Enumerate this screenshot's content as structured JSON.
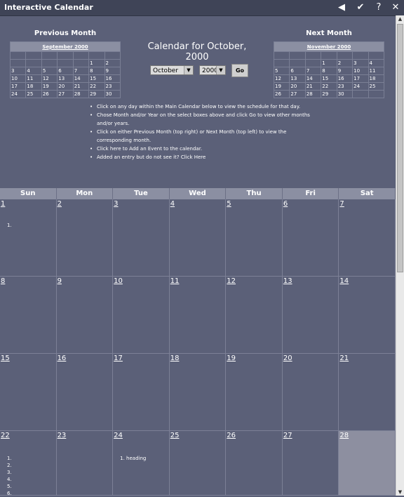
{
  "window": {
    "title": "Interactive Calendar",
    "buttons": [
      "◀",
      "✔",
      "?",
      "✕"
    ]
  },
  "prev": {
    "heading": "Previous Month",
    "month_label": "September 2000",
    "rows": [
      [
        "",
        "",
        "",
        "",
        "",
        "1",
        "2"
      ],
      [
        "3",
        "4",
        "5",
        "6",
        "7",
        "8",
        "9"
      ],
      [
        "10",
        "11",
        "12",
        "13",
        "14",
        "15",
        "16"
      ],
      [
        "17",
        "18",
        "19",
        "20",
        "21",
        "22",
        "23"
      ],
      [
        "24",
        "25",
        "26",
        "27",
        "28",
        "29",
        "30"
      ]
    ]
  },
  "next": {
    "heading": "Next Month",
    "month_label": "November 2000",
    "rows": [
      [
        "",
        "",
        "",
        "1",
        "2",
        "3",
        "4"
      ],
      [
        "5",
        "6",
        "7",
        "8",
        "9",
        "10",
        "11"
      ],
      [
        "12",
        "13",
        "14",
        "15",
        "16",
        "17",
        "18"
      ],
      [
        "19",
        "20",
        "21",
        "22",
        "23",
        "24",
        "25"
      ],
      [
        "26",
        "27",
        "28",
        "29",
        "30",
        "",
        ""
      ]
    ]
  },
  "main": {
    "title": "Calendar for October, 2000",
    "month_value": "October",
    "year_value": "2000",
    "go_label": "Go"
  },
  "instructions": [
    "Click on any day within the Main Calendar below to view the schedule for that day.",
    "Chose Month and/or Year on the select boxes above and click Go to view other months and/or years.",
    "Click on either Previous Month (top right) or Next Month (top left) to view the corresponding month.",
    "Click here to Add an Event to the calendar.",
    "Added an entry but do not see it? Click Here"
  ],
  "calendar": {
    "days": [
      "Sun",
      "Mon",
      "Tue",
      "Wed",
      "Thu",
      "Fri",
      "Sat"
    ],
    "weeks": [
      [
        "1",
        "2",
        "3",
        "4",
        "5",
        "6",
        "7"
      ],
      [
        "8",
        "9",
        "10",
        "11",
        "12",
        "13",
        "14"
      ],
      [
        "15",
        "16",
        "17",
        "18",
        "19",
        "20",
        "21"
      ],
      [
        "22",
        "23",
        "24",
        "25",
        "26",
        "27",
        "28"
      ]
    ],
    "events": {
      "1": [
        "1."
      ],
      "22": [
        "1.",
        "2.",
        "3.",
        "4.",
        "5.",
        "6."
      ],
      "24": [
        "1.   heading"
      ]
    },
    "today": "28"
  }
}
